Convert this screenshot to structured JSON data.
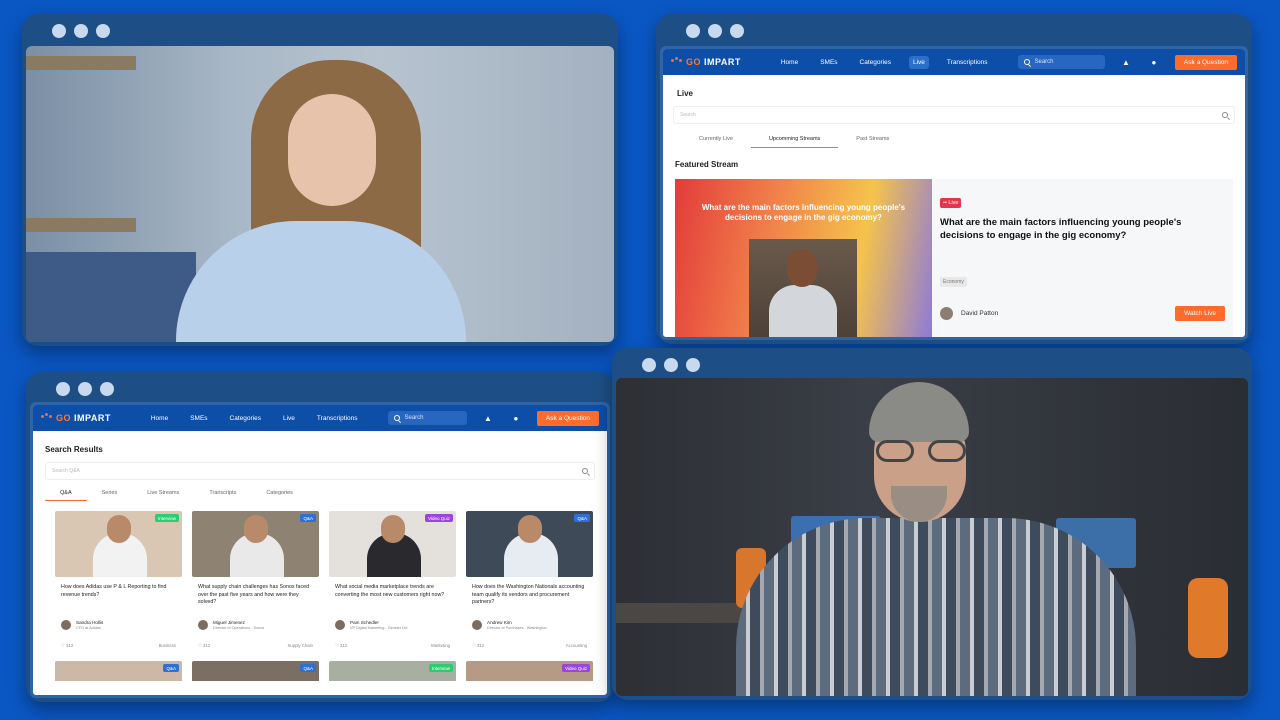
{
  "nav": {
    "logo_go": "GO",
    "logo_rest": "IMPART",
    "home": "Home",
    "smes": "SMEs",
    "categories": "Categories",
    "live": "Live",
    "transcriptions": "Transcriptions",
    "search_placeholder": "Search",
    "ask": "Ask a Question"
  },
  "live_page": {
    "title": "Live",
    "search_placeholder": "Search",
    "tabs": [
      "Currently Live",
      "Upcomming Streams",
      "Past Streams"
    ],
    "featured_title": "Featured Stream",
    "featured": {
      "media_question": "What are the main factors influencing young people's decisions to engage in the gig economy?",
      "badge": "Live",
      "question": "What are the main factors influencing young people's decisions to engage in the gig economy?",
      "tag": "Economy",
      "author": "David Patton",
      "button": "Watch Live"
    }
  },
  "search_page": {
    "title": "Search Results",
    "search_placeholder": "Search Q&A",
    "tabs": [
      "Q&A",
      "Series",
      "Live Streams",
      "Transcripts",
      "Categories"
    ],
    "cards": [
      {
        "badge": "Interview",
        "badge_color": "green",
        "question": "How does Adidas use P & L Reporting to find revenue trends?",
        "author": "Sandra Hollis",
        "role": "CFO at Adidas",
        "count": "312",
        "category": "Business",
        "thumb_bg": "#d9c7b3",
        "shirt": "#f2f2f2"
      },
      {
        "badge": "Q&A",
        "badge_color": "blue",
        "question": "What supply chain challenges has Sonos faced over the past five years and how were they solved?",
        "author": "Miguel Jimenez",
        "role": "Director of Operations - Sonos",
        "count": "312",
        "category": "Supply Chain",
        "thumb_bg": "#8e8272",
        "shirt": "#e9e9ea"
      },
      {
        "badge": "Video Quiz",
        "badge_color": "purple",
        "question": "What social media marketplace trends are converting the most new customers right now?",
        "author": "Pam Schedler",
        "role": "VP Digital Marketing - Gensler Ltd",
        "count": "312",
        "category": "Marketing",
        "thumb_bg": "#e4e1dd",
        "shirt": "#2a2a2e"
      },
      {
        "badge": "Q&A",
        "badge_color": "blue",
        "question": "How does the Washington Nationals accounting team qualify its vendors and procurement partners?",
        "author": "Andrew Kim",
        "role": "Director of Purchases - Washington",
        "count": "312",
        "category": "Accounting",
        "thumb_bg": "#3f4a58",
        "shirt": "#e6ecf2"
      }
    ],
    "row2_badges": [
      {
        "badge": "Q&A",
        "badge_color": "blue",
        "thumb_bg": "#cbb8a6"
      },
      {
        "badge": "Q&A",
        "badge_color": "blue",
        "thumb_bg": "#7b6e62"
      },
      {
        "badge": "Interview",
        "badge_color": "green",
        "thumb_bg": "#a7b0a0"
      },
      {
        "badge": "Video Quiz",
        "badge_color": "purple",
        "thumb_bg": "#b59a85"
      }
    ]
  }
}
